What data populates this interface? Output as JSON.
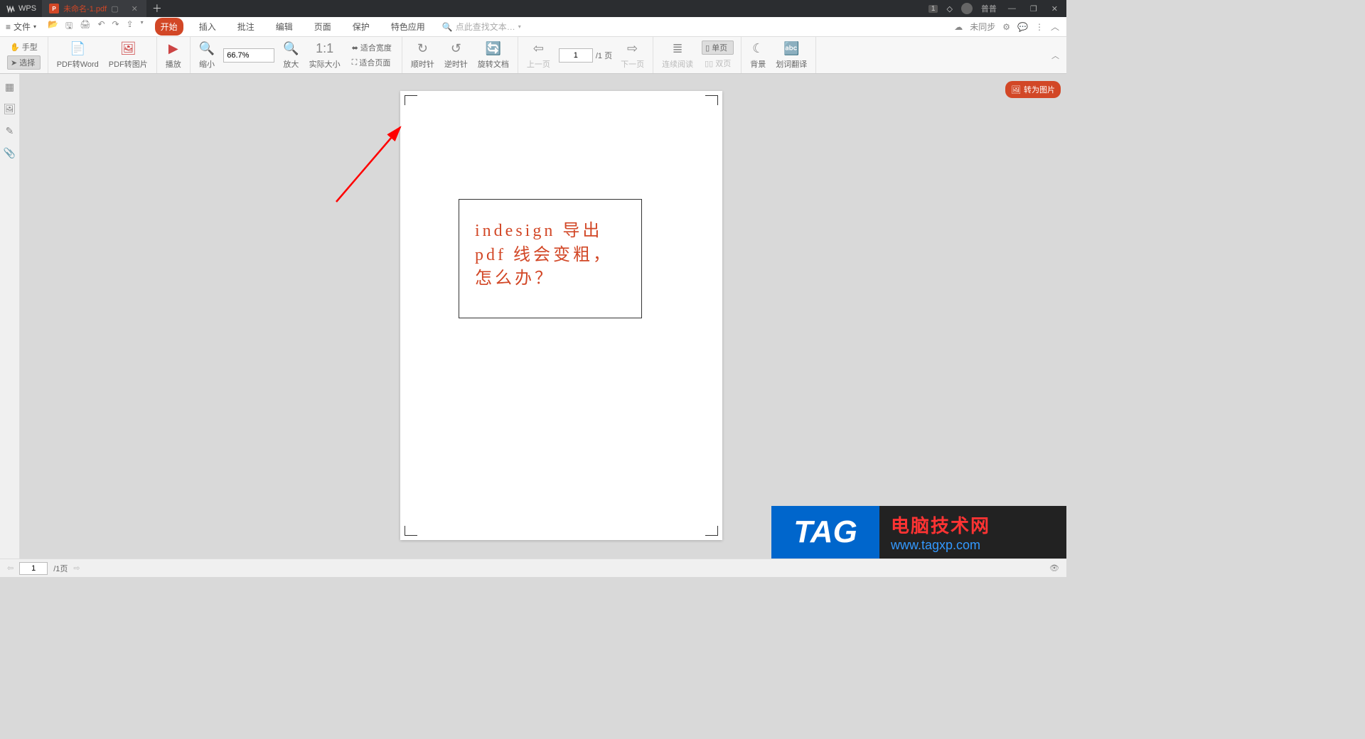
{
  "titlebar": {
    "app": "WPS",
    "tab_name": "未命名-1.pdf",
    "pdf_badge": "P",
    "notif": "1",
    "username": "普普"
  },
  "menubar": {
    "file": "文件",
    "tabs": [
      "开始",
      "插入",
      "批注",
      "编辑",
      "页面",
      "保护",
      "特色应用"
    ],
    "search_placeholder": "点此查找文本…",
    "sync": "未同步"
  },
  "ribbon": {
    "hand": "手型",
    "select": "选择",
    "pdf2word": "PDF转Word",
    "pdf2img": "PDF转图片",
    "play": "播放",
    "zoomout": "缩小",
    "zoom_value": "66.7%",
    "zoomin": "放大",
    "actualsize": "实际大小",
    "fitwidth": "适合宽度",
    "fitpage": "适合页面",
    "rot_cw": "顺时针",
    "rot_ccw": "逆时针",
    "rot_doc": "旋转文档",
    "prev": "上一页",
    "page_value": "1",
    "page_total": "/1 页",
    "next": "下一页",
    "cont_read": "连续阅读",
    "single_page": "单页",
    "double_page": "双页",
    "background": "背景",
    "dict": "划词翻译"
  },
  "document": {
    "text": "indesign 导出 pdf 线会变粗，怎么办？"
  },
  "floatbtn": "转为图片",
  "watermark": {
    "tag": "TAG",
    "line1": "电脑技术网",
    "line2": "www.tagxp.com"
  },
  "statusbar": {
    "page_value": "1",
    "page_total": "/1页"
  }
}
